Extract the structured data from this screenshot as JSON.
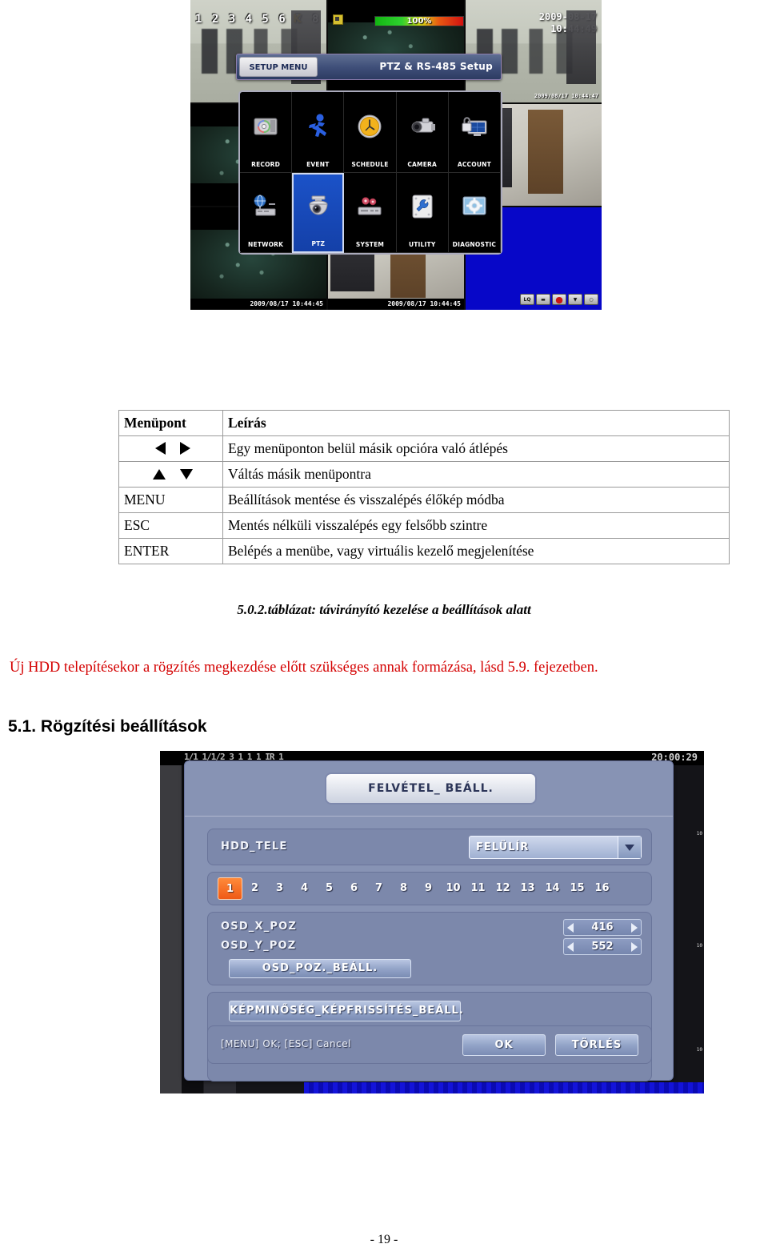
{
  "top_screenshot": {
    "channel_numbers": "1 2 3 4 5 6 7 8",
    "k_icon": "K",
    "hdd_percent": "100%",
    "datestamp_date": "2009-08-17",
    "datestamp_time": "10:44:49",
    "datestamp_small_right": "2009/08/17  10:44:47",
    "datestamp_strip_1": "2009/08/17  10:44:45",
    "datestamp_strip_2": "2009/08/17  10:44:45",
    "setup_bar": {
      "tag_label": "SETUP MENU",
      "title": "PTZ & RS-485 Setup"
    },
    "menu_items": [
      {
        "label": "RECORD",
        "icon": "hdd-disc-icon",
        "selected": false
      },
      {
        "label": "EVENT",
        "icon": "running-man-icon",
        "selected": false
      },
      {
        "label": "SCHEDULE",
        "icon": "clock-icon",
        "selected": false
      },
      {
        "label": "CAMERA",
        "icon": "camcorder-icon",
        "selected": false
      },
      {
        "label": "ACCOUNT",
        "icon": "lock-monitor-icon",
        "selected": false
      },
      {
        "label": "NETWORK",
        "icon": "globe-network-icon",
        "selected": false
      },
      {
        "label": "PTZ",
        "icon": "dome-camera-icon",
        "selected": true
      },
      {
        "label": "SYSTEM",
        "icon": "gears-rack-icon",
        "selected": false
      },
      {
        "label": "UTILITY",
        "icon": "wrench-icon",
        "selected": false
      },
      {
        "label": "DIAGNOSTIC",
        "icon": "gear-screen-icon",
        "selected": false
      }
    ],
    "status_icons": [
      {
        "name": "lq-icon",
        "glyph": "LQ"
      },
      {
        "name": "monitor-icon",
        "glyph": "▬"
      },
      {
        "name": "record-icon",
        "glyph": "●"
      },
      {
        "name": "trash-icon",
        "glyph": "▼"
      },
      {
        "name": "camera-icon",
        "glyph": "○"
      }
    ]
  },
  "table": {
    "headers": [
      "Menüpont",
      "Leírás"
    ],
    "rows": [
      {
        "key_type": "arrows-lr",
        "key_label": "",
        "desc": "Egy menüponton belül másik opcióra való átlépés"
      },
      {
        "key_type": "arrows-ud",
        "key_label": "",
        "desc": "Váltás másik menüpontra"
      },
      {
        "key_type": "text",
        "key_label": "MENU",
        "desc": "Beállítások mentése és visszalépés élőkép módba"
      },
      {
        "key_type": "text",
        "key_label": "ESC",
        "desc": "Mentés nélküli visszalépés egy felsőbb szintre"
      },
      {
        "key_type": "text",
        "key_label": "ENTER",
        "desc": "Belépés a menübe, vagy virtuális kezelő megjelenítése"
      }
    ]
  },
  "table_caption": "5.0.2.táblázat: távirányító kezelése a beállítások alatt",
  "warning_text": "Új HDD telepítésekor a rögzítés megkezdése előtt szükséges annak formázása, lásd 5.9. fejezetben.",
  "warning_color": "#d40000",
  "section_heading": "5.1. Rögzítési beállítások",
  "bottom_screenshot": {
    "osd_top_numbers": "1/1  1/1/2 3  1   1  1   IR  1",
    "clock": "20:00:29",
    "dialog": {
      "title": "FELVÉTEL_ BEÁLL.",
      "hdd_tele": {
        "label": "HDD_TELE",
        "value": "FELÜLÍR"
      },
      "channels": [
        "1",
        "2",
        "3",
        "4",
        "5",
        "6",
        "7",
        "8",
        "9",
        "10",
        "11",
        "12",
        "13",
        "14",
        "15",
        "16"
      ],
      "channel_selected": "1",
      "osd_x": {
        "label": "OSD_X_POZ",
        "value": "416"
      },
      "osd_y": {
        "label": "OSD_Y_POZ",
        "value": "552"
      },
      "osd_pos_button": "OSD_POZ._BEÁLL.",
      "quality_button": "KÉPMINŐSÉG_KÉPFRISSÍTÉS_BEÁLL.",
      "footer_hint": "[MENU] OK; [ESC] Cancel",
      "ok_button": "OK",
      "delete_button": "TÖRLÉS"
    }
  },
  "page_number": "- 19 -"
}
